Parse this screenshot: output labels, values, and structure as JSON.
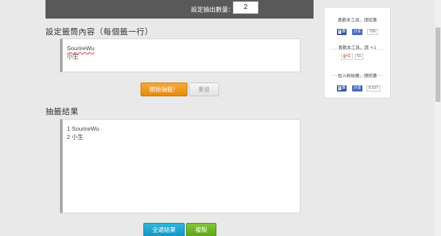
{
  "top_bar": {
    "count_label": "設定抽出數量：",
    "count_value": "2"
  },
  "items_section": {
    "heading": "設定籤筒內容（每個籤一行）",
    "lines": [
      "SourireWu",
      "小生"
    ]
  },
  "buttons": {
    "start": "開始抽籤！",
    "reset": "重設",
    "select_all": "全選結果",
    "copy": "複製"
  },
  "result_section": {
    "heading": "抽籤結果",
    "lines": [
      "1 SourireWu",
      "2 小生"
    ]
  },
  "sidebar": {
    "like_prompt": "喜歡本工具，請按讚",
    "fb_like": "讚",
    "fb_share": "分享",
    "fb_like_count": "735",
    "plus_one_prompt": "喜歡本工具，請 +1",
    "gplus_label": "g+1",
    "gplus_count": "51",
    "fan_prompt": "加入粉絲團，請按讚",
    "fb_fan_count": "8,537"
  },
  "colors": {
    "start_button": "#e68a0c",
    "select_all_button": "#1596c3",
    "copy_button": "#5ea51c",
    "top_bar": "#595959"
  }
}
